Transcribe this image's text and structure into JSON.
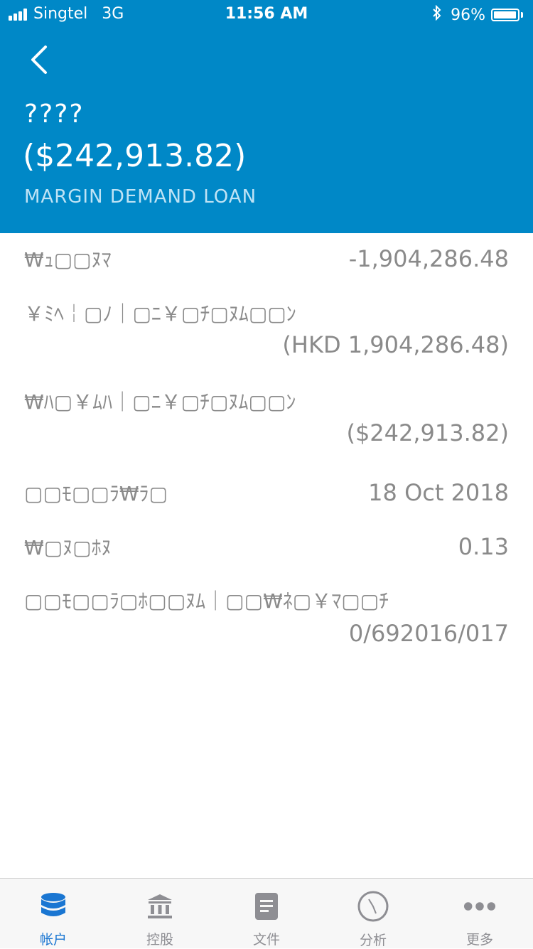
{
  "status_bar": {
    "carrier": "Singtel",
    "network": "3G",
    "time": "11:56 AM",
    "battery_percent": "96%",
    "battery_level": 0.96,
    "signal_bars": 4
  },
  "header": {
    "account_name": "????",
    "balance": "($242,913.82)",
    "account_type": "MARGIN DEMAND LOAN",
    "background_color": "#0088c7"
  },
  "details": [
    {
      "label": "₩ｭ▢▢ﾇﾏ",
      "value": "-1,904,286.48"
    },
    {
      "label": "￥ﾐﾍ￤▢ﾉ｜▢ﾆ￥▢ﾁ▢ﾇﾑ▢▢ﾝ",
      "value": "(HKD 1,904,286.48)"
    },
    {
      "label": "₩ﾊ▢￥ﾑﾊ｜▢ﾆ￥▢ﾁ▢ﾇﾑ▢▢ﾝ",
      "value": "($242,913.82)"
    },
    {
      "label": "▢▢ﾓ▢▢ﾗ₩ﾗ▢",
      "value": "18 Oct 2018"
    },
    {
      "label": "₩▢ﾇ▢ﾎﾇ",
      "value": "0.13"
    },
    {
      "label": "▢▢ﾓ▢▢ﾗ▢ﾎ▢▢ﾇﾑ｜▢▢₩ﾈ▢￥ﾏ▢▢ﾁ",
      "value": "0/692016/017"
    }
  ],
  "tabs": [
    {
      "label": "帐户",
      "icon": "database-icon",
      "active": true
    },
    {
      "label": "控股",
      "icon": "bank-icon",
      "active": false
    },
    {
      "label": "文件",
      "icon": "document-icon",
      "active": false
    },
    {
      "label": "分析",
      "icon": "compass-icon",
      "active": false
    },
    {
      "label": "更多",
      "icon": "more-icon",
      "active": false
    }
  ],
  "colors": {
    "accent": "#1a76d2",
    "text_gray": "#8a8a8a"
  }
}
